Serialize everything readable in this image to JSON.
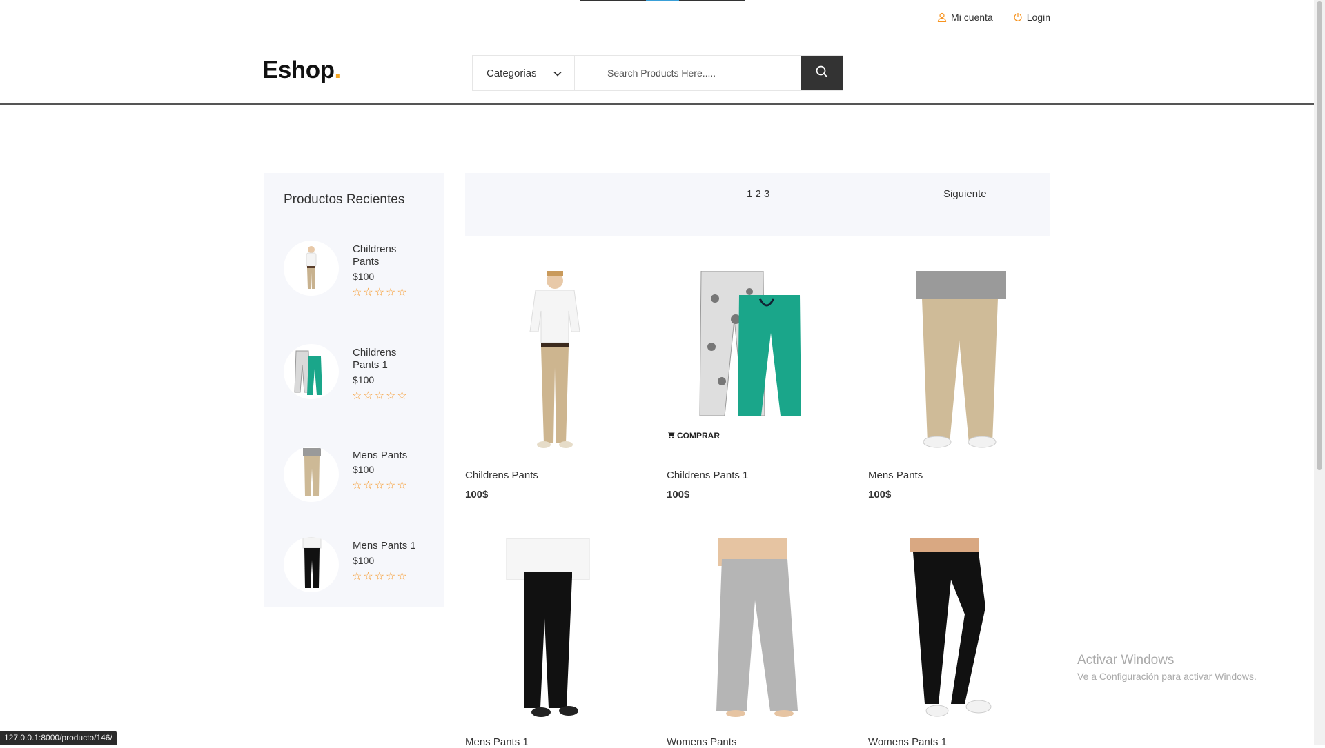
{
  "topbar": {
    "account_label": "Mi cuenta",
    "login_label": "Login"
  },
  "header": {
    "logo_text": "Eshop",
    "logo_dot": ".",
    "category_label": "Categorias",
    "search_placeholder": "Search Products Here....."
  },
  "sidebar": {
    "title": "Productos Recientes",
    "items": [
      {
        "name": "Childrens Pants",
        "price": "$100",
        "stars": "☆☆☆☆☆"
      },
      {
        "name": "Childrens Pants 1",
        "price": "$100",
        "stars": "☆☆☆☆☆"
      },
      {
        "name": "Mens Pants",
        "price": "$100",
        "stars": "☆☆☆☆☆"
      },
      {
        "name": "Mens Pants 1",
        "price": "$100",
        "stars": "☆☆☆☆☆"
      }
    ]
  },
  "pagination": {
    "pages": "1 2 3",
    "next_label": "Siguiente"
  },
  "products": [
    {
      "title": "Childrens Pants",
      "price": "100$"
    },
    {
      "title": "Childrens Pants 1",
      "price": "100$",
      "action": "COMPRAR"
    },
    {
      "title": "Mens Pants",
      "price": "100$"
    },
    {
      "title": "Mens Pants 1",
      "price": ""
    },
    {
      "title": "Womens Pants",
      "price": ""
    },
    {
      "title": "Womens Pants 1",
      "price": ""
    }
  ],
  "windows_watermark": {
    "line1": "Activar Windows",
    "line2": "Ve a Configuración para activar Windows."
  },
  "status_bar": {
    "url": "127.0.0.1:8000/producto/146/"
  },
  "colors": {
    "accent": "#f7931e",
    "logo_dot": "#f5a623",
    "dark": "#333333",
    "panel_bg": "#f6f7fb"
  }
}
